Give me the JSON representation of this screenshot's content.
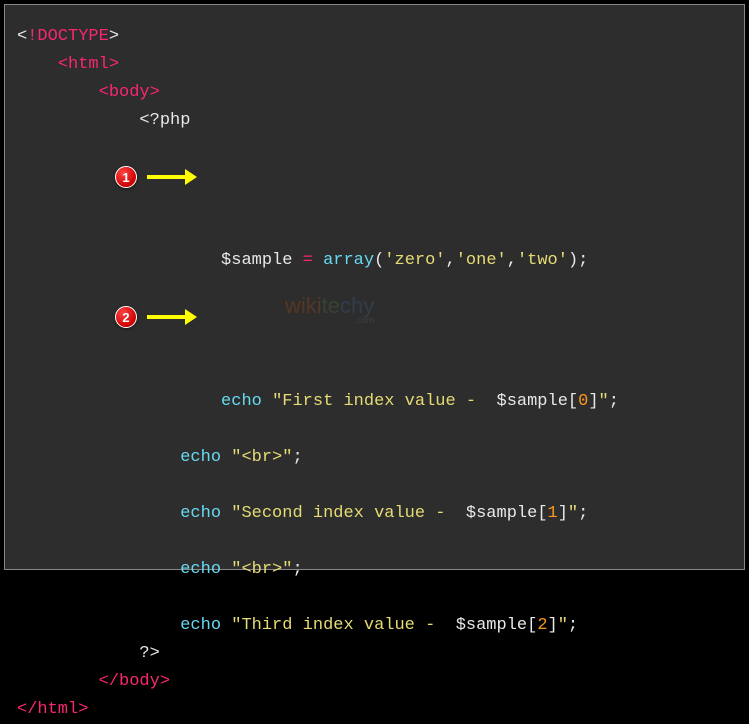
{
  "code": {
    "doctype_open": "<",
    "doctype_bang": "!",
    "doctype_name": "DOCTYPE",
    "doctype_close": ">",
    "html_open": "<html>",
    "body_open": "<body>",
    "php_open": "<?php",
    "var_sample": "$sample",
    "equals": " = ",
    "array_fn": "array",
    "paren_open": "(",
    "str_zero": "'zero'",
    "comma": ",",
    "str_one": "'one'",
    "str_two": "'two'",
    "paren_close": ")",
    "semicolon": ";",
    "echo": "echo",
    "space": " ",
    "str_first_a": "\"First index value -  ",
    "interp_sample": "$sample",
    "bracket_open": "[",
    "idx0": "0",
    "idx1": "1",
    "idx2": "2",
    "bracket_close": "]",
    "str_close": "\"",
    "str_br": "\"<br>\"",
    "str_second_a": "\"Second index value -  ",
    "str_third_a": "\"Third index value -  ",
    "php_close": "?>",
    "body_close": "</body>",
    "html_close": "</html>"
  },
  "annotations": {
    "badge1": "1",
    "badge2": "2"
  },
  "watermark": {
    "text1": "wiki",
    "text2": "te",
    "text3": "chy",
    "sub": ".com"
  }
}
